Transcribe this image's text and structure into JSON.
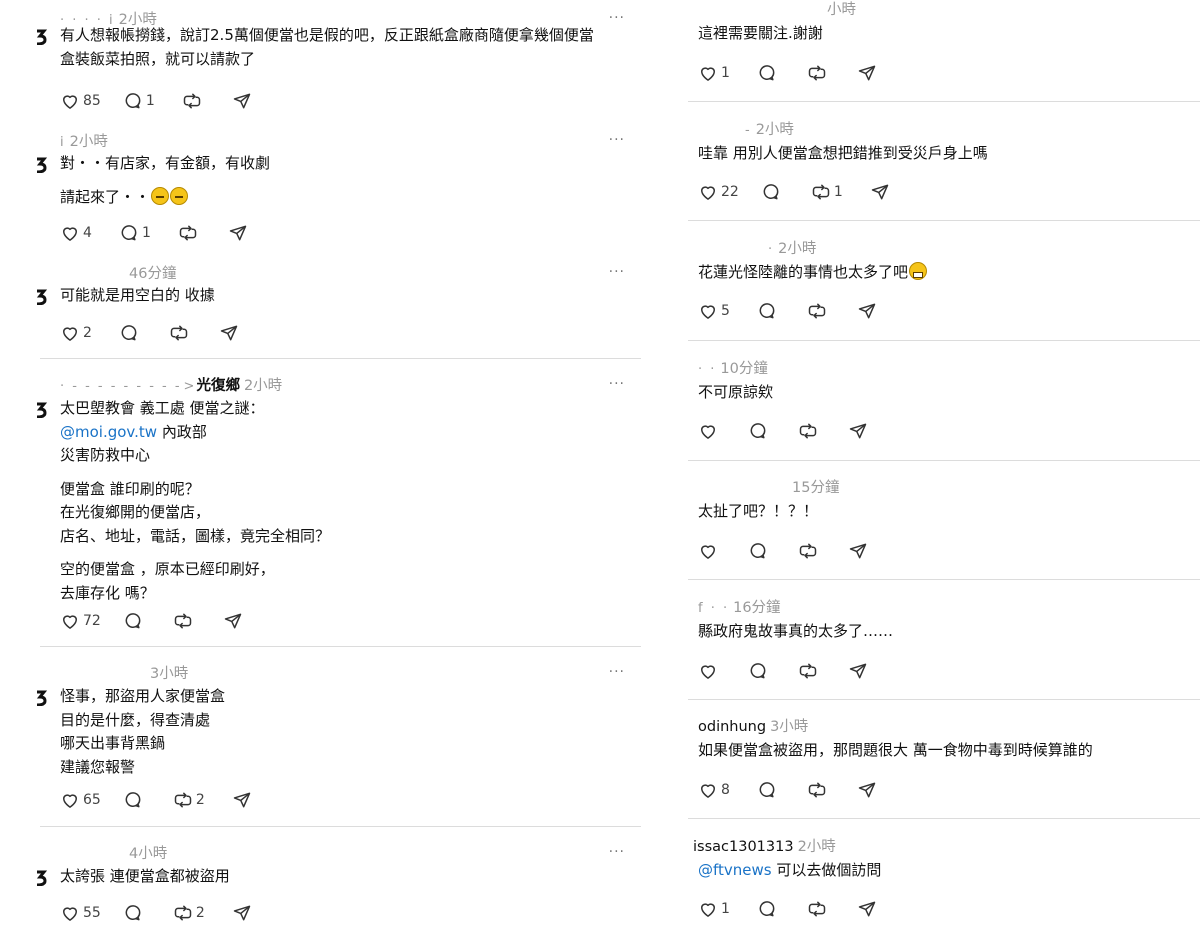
{
  "left": {
    "posts": [
      {
        "name": "· ·  · · i",
        "time": "2小時",
        "more": "···",
        "paragraphs": [
          "有人想報帳撈錢，說訂2.5萬個便當也是假的吧，反正跟紙盒廠商隨便拿幾個便當\n盒裝飯菜拍照，就可以請款了"
        ],
        "likes": "85",
        "replies": "1",
        "reposts": ""
      },
      {
        "name": "i",
        "time": "2小時",
        "more": "···",
        "paragraphs": [
          "對・・有店家，有金額，有收劇",
          "請起來了・・"
        ],
        "emoji_count": 2,
        "likes": "4",
        "replies": "1",
        "reposts": ""
      },
      {
        "name": "",
        "time": "46分鐘",
        "more": "···",
        "paragraphs": [
          "可能就是用空白的 收據"
        ],
        "likes": "2",
        "replies": "",
        "reposts": ""
      },
      {
        "name": "· - - - - - - - - -",
        "chevron": ">",
        "reply_to": "光復鄉",
        "time": "2小時",
        "more": "···",
        "line1": "太巴塱教會 義工處 便當之謎：",
        "mention": "@moi.gov.tw",
        "mention_rest": " 內政部",
        "line3": "災害防救中心",
        "paragraphs": [
          "便當盒 誰印刷的呢？\n在光復鄉開的便當店，\n店名、地址，電話，圖樣，竟完全相同？",
          "空的便當盒 ，原本已經印刷好，\n去庫存化 嗎？"
        ],
        "likes": "72",
        "replies": "",
        "reposts": ""
      },
      {
        "name": "",
        "time": "3小時",
        "more": "···",
        "paragraphs": [
          "怪事，那盜用人家便當盒\n目的是什麼，得查清處\n哪天出事背黑鍋\n建議您報警"
        ],
        "likes": "65",
        "replies": "",
        "reposts": "2"
      },
      {
        "name": "",
        "time": "4小時",
        "more": "···",
        "paragraphs": [
          "太誇張 連便當盒都被盜用"
        ],
        "likes": "55",
        "replies": "",
        "reposts": "2"
      }
    ]
  },
  "right": {
    "posts": [
      {
        "name": "",
        "time": "小時",
        "paragraphs": [
          "這裡需要關注.謝謝"
        ],
        "likes": "1",
        "replies": "",
        "reposts": ""
      },
      {
        "name": "-",
        "time": "2小時",
        "paragraphs": [
          "哇靠 用別人便當盒想把錯推到受災戶身上嗎"
        ],
        "likes": "22",
        "replies": "",
        "reposts": "1"
      },
      {
        "name": "·",
        "time": "2小時",
        "paragraphs": [
          "花蓮光怪陸離的事情也太多了吧"
        ],
        "likes": "5",
        "replies": "",
        "reposts": ""
      },
      {
        "name": "· ·",
        "time": "10分鐘",
        "paragraphs": [
          "不可原諒欸"
        ],
        "likes": "",
        "replies": "",
        "reposts": ""
      },
      {
        "name": "",
        "time": "15分鐘",
        "paragraphs": [
          "太扯了吧？！？！"
        ],
        "likes": "",
        "replies": "",
        "reposts": ""
      },
      {
        "name": "f  · ·",
        "time": "16分鐘",
        "paragraphs": [
          "縣政府鬼故事真的太多了……"
        ],
        "likes": "",
        "replies": "",
        "reposts": ""
      },
      {
        "name": "odinhung",
        "time": "3小時",
        "paragraphs": [
          "如果便當盒被盜用，那問題很大 萬一食物中毒到時候算誰的"
        ],
        "likes": "8",
        "replies": "",
        "reposts": ""
      },
      {
        "name": "issac1301313",
        "time": "2小時",
        "mention": "@ftvnews",
        "mention_rest": " 可以去做個訪問",
        "likes": "1",
        "replies": "",
        "reposts": ""
      }
    ]
  },
  "icons": [
    "heart-icon",
    "reply-icon",
    "repost-icon",
    "share-icon",
    "more-icon"
  ],
  "colors": {
    "link": "#1a73c7",
    "meta": "#999999",
    "separator": "#dcdcdc"
  }
}
